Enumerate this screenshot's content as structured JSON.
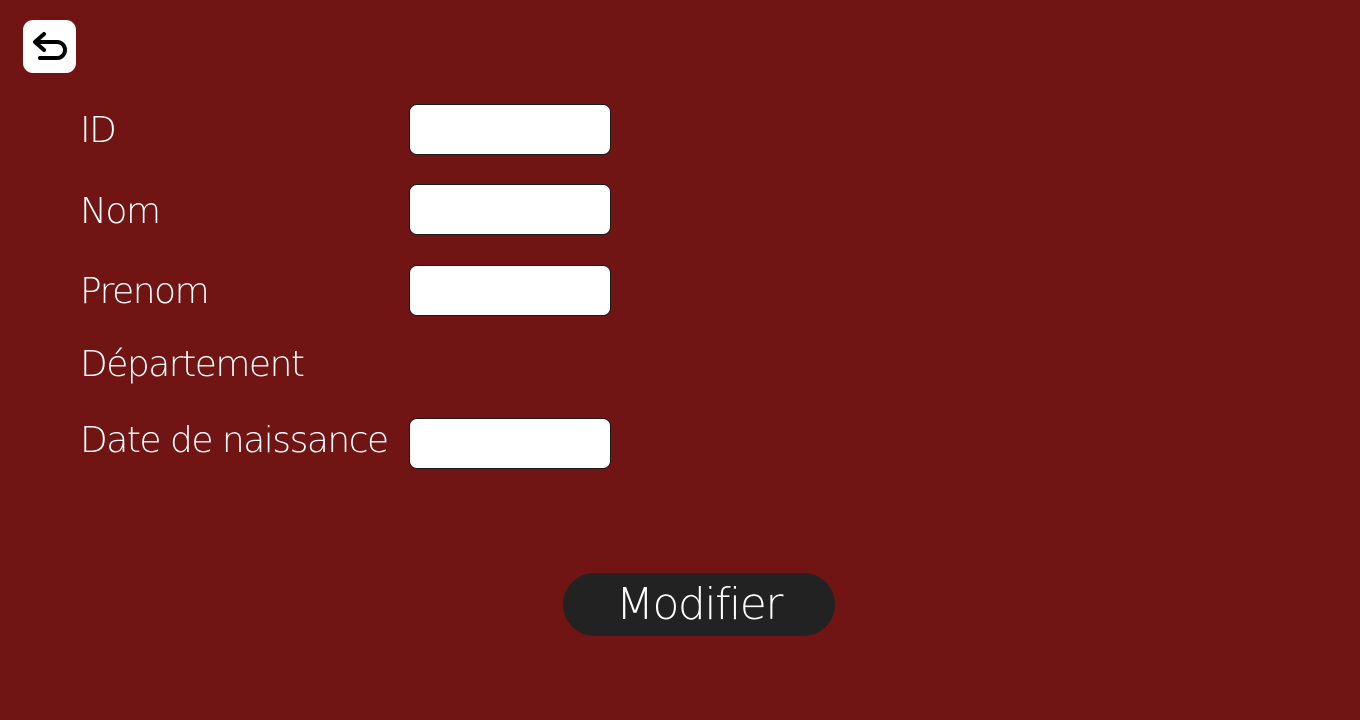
{
  "nav": {
    "back_icon": "back-arrow-icon"
  },
  "form": {
    "fields": [
      {
        "label": "ID",
        "value": "",
        "placeholder": ""
      },
      {
        "label": "Nom",
        "value": "",
        "placeholder": ""
      },
      {
        "label": "Prenom",
        "value": "",
        "placeholder": ""
      },
      {
        "label": "Département"
      },
      {
        "label": "Date de naissance",
        "value": "",
        "placeholder": ""
      }
    ],
    "submit_label": "Modifier"
  },
  "colors": {
    "background": "#701414",
    "button": "#222222",
    "text": "#ffffff",
    "field_background": "#ffffff"
  }
}
